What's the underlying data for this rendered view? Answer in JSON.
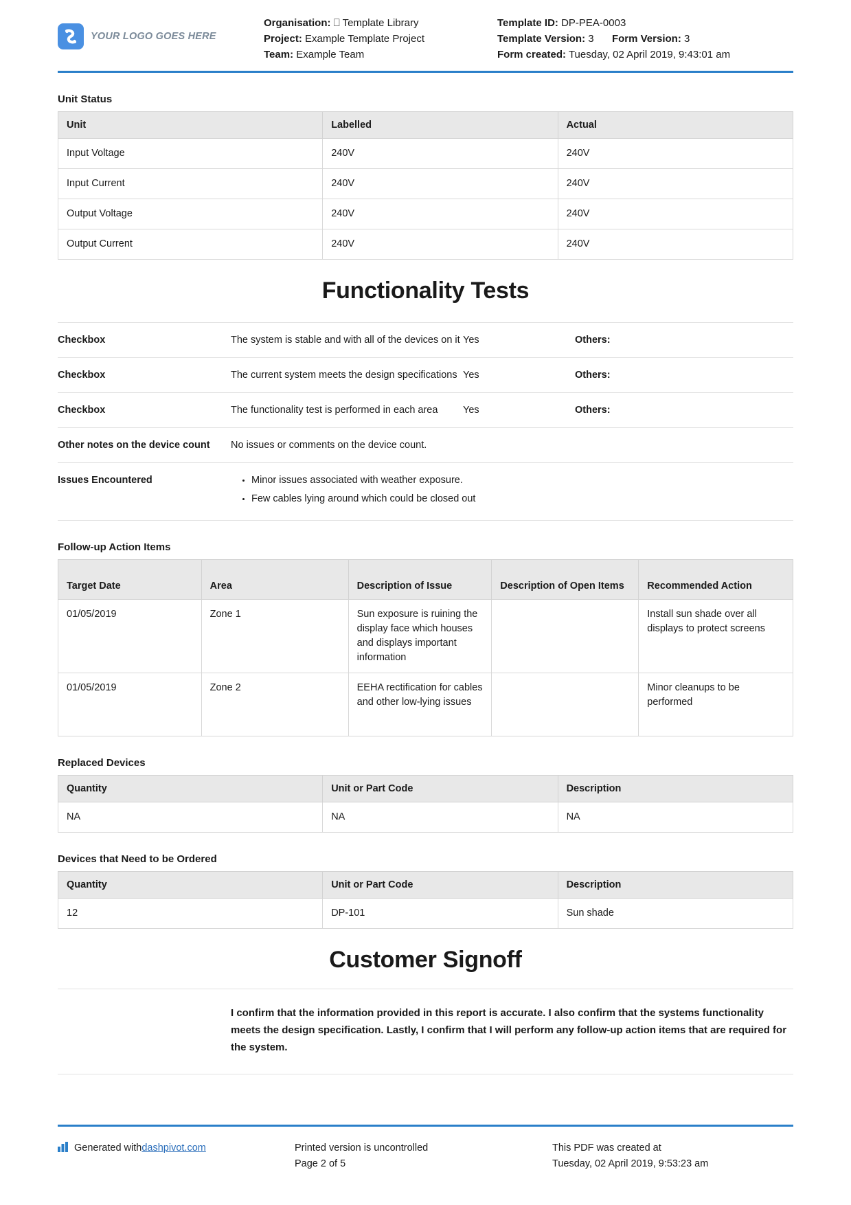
{
  "header": {
    "logo_text": "YOUR LOGO GOES HERE",
    "organisation_label": "Organisation:",
    "organisation_value": "⎕ Template Library",
    "project_label": "Project:",
    "project_value": "Example Template Project",
    "team_label": "Team:",
    "team_value": "Example Team",
    "template_id_label": "Template ID:",
    "template_id_value": "DP-PEA-0003",
    "template_version_label": "Template Version:",
    "template_version_value": "3",
    "form_version_label": "Form Version:",
    "form_version_value": "3",
    "form_created_label": "Form created:",
    "form_created_value": "Tuesday, 02 April 2019, 9:43:01 am"
  },
  "unit_status": {
    "title": "Unit Status",
    "columns": [
      "Unit",
      "Labelled",
      "Actual"
    ],
    "rows": [
      [
        "Input Voltage",
        "240V",
        "240V"
      ],
      [
        "Input Current",
        "240V",
        "240V"
      ],
      [
        "Output Voltage",
        "240V",
        "240V"
      ],
      [
        "Output Current",
        "240V",
        "240V"
      ]
    ]
  },
  "functionality_tests": {
    "heading": "Functionality Tests",
    "checkbox_rows": [
      {
        "label": "Checkbox",
        "question": "The system is stable and with all of the devices on it",
        "answer": "Yes",
        "others": "Others:"
      },
      {
        "label": "Checkbox",
        "question": "The current system meets the design specifications",
        "answer": "Yes",
        "others": "Others:"
      },
      {
        "label": "Checkbox",
        "question": "The functionality test is performed in each area",
        "answer": "Yes",
        "others": "Others:"
      }
    ],
    "other_notes": {
      "label": "Other notes on the device count",
      "value": "No issues or comments on the device count."
    },
    "issues": {
      "label": "Issues Encountered",
      "items": [
        "Minor issues associated with weather exposure.",
        "Few cables lying around which could be closed out"
      ]
    }
  },
  "follow_up": {
    "title": "Follow-up Action Items",
    "columns": [
      "Target Date",
      "Area",
      "Description of Issue",
      "Description of Open Items",
      "Recommended Action"
    ],
    "rows": [
      [
        "01/05/2019",
        "Zone 1",
        "Sun exposure is ruining the display face which houses and displays important information",
        "",
        "Install sun shade over all displays to protect screens"
      ],
      [
        "01/05/2019",
        "Zone 2",
        "EEHA rectification for cables and other low-lying issues",
        "",
        "Minor cleanups to be performed"
      ]
    ]
  },
  "replaced_devices": {
    "title": "Replaced Devices",
    "columns": [
      "Quantity",
      "Unit or Part Code",
      "Description"
    ],
    "rows": [
      [
        "NA",
        "NA",
        "NA"
      ]
    ]
  },
  "ordered_devices": {
    "title": "Devices that Need to be Ordered",
    "columns": [
      "Quantity",
      "Unit or Part Code",
      "Description"
    ],
    "rows": [
      [
        "12",
        "DP-101",
        "Sun shade"
      ]
    ]
  },
  "customer_signoff": {
    "heading": "Customer Signoff",
    "confirmation": "I confirm that the information provided in this report is accurate. I also confirm that the systems functionality meets the design specification. Lastly, I confirm that I will perform any follow-up action items that are required for the system."
  },
  "footer": {
    "generated_prefix": "Generated with ",
    "generated_link": "dashpivot.com",
    "uncontrolled_note": "Printed version is uncontrolled",
    "page_label": "Page 2 of 5",
    "created_at_label": "This PDF was created at",
    "created_at_value": "Tuesday, 02 April 2019, 9:53:23 am"
  },
  "colors": {
    "accent_blue": "#2a7fc9",
    "logo_blue": "#4a90e2",
    "link_blue": "#2a6ebb",
    "table_header_bg": "#e8e8e8"
  }
}
